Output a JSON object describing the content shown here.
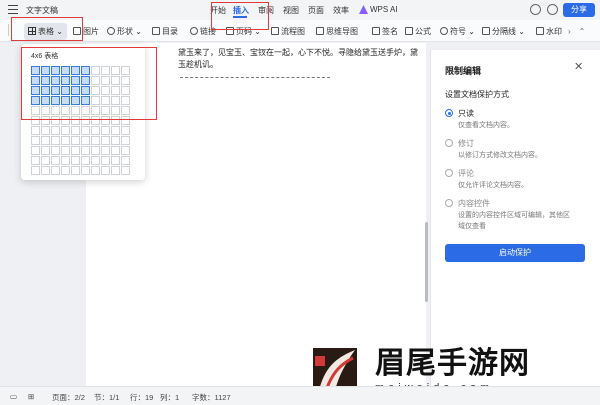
{
  "titlebar": {
    "doc_title": "文字文稿",
    "tabs": [
      {
        "label": "开始"
      },
      {
        "label": "插入",
        "active": true
      },
      {
        "label": "审阅"
      },
      {
        "label": "视图"
      },
      {
        "label": "页面"
      },
      {
        "label": "效率"
      },
      {
        "label": "WPS AI"
      }
    ],
    "share_label": "分享"
  },
  "toolbar": {
    "items": [
      "表格",
      "图片",
      "形状",
      "目录",
      "链接",
      "页码",
      "流程图",
      "思维导图",
      "签名",
      "公式",
      "符号",
      "分隔线",
      "水印"
    ]
  },
  "table_dropdown": {
    "size_label": "4x6 表格",
    "columns": 10,
    "rows": 11,
    "selected_cols": 6,
    "selected_rows": 4
  },
  "document": {
    "text": "黛玉来了，见宝玉、宝钗在一起，心下不悦。寻隐给黛玉送手炉，黛玉趁机讥。"
  },
  "protection_panel": {
    "title": "限制编辑",
    "close_icon": "close-icon",
    "section": "设置文档保护方式",
    "options": [
      {
        "label": "只读",
        "desc": "仅查看文档内容。",
        "selected": true
      },
      {
        "label": "修订",
        "desc": "以修订方式修改文档内容。",
        "selected": false
      },
      {
        "label": "评论",
        "desc": "仅允许评论文档内容。",
        "selected": false
      },
      {
        "label": "内容控件",
        "desc": "设置的内容控件区域可编辑，其他区域仅查看",
        "selected": false
      }
    ],
    "start_button": "启动保护"
  },
  "statusbar": {
    "page": "页面：2/2",
    "section": "节：1/1",
    "row": "行：19",
    "col": "列：1",
    "wordcount": "字数：1127"
  },
  "watermark": {
    "text": "眉尾手游网",
    "url": "meiweida.com"
  },
  "colors": {
    "accent": "#2b6be6",
    "highlight": "#e03a3a",
    "selected_cell": "#c8dcf6"
  }
}
